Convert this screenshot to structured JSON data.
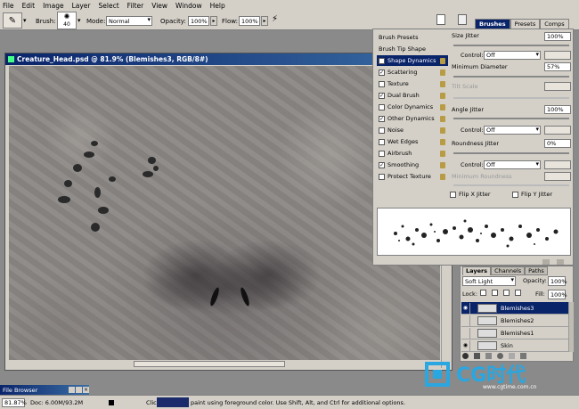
{
  "menu": [
    "File",
    "Edit",
    "Image",
    "Layer",
    "Select",
    "Filter",
    "View",
    "Window",
    "Help"
  ],
  "options_bar": {
    "brush_label": "Brush:",
    "brush_size": "40",
    "mode_label": "Mode:",
    "mode_value": "Normal",
    "opacity_label": "Opacity:",
    "opacity_value": "100%",
    "flow_label": "Flow:",
    "flow_value": "100%"
  },
  "palette_well": {
    "tabs": [
      "Brushes",
      "Presets",
      "Comps"
    ]
  },
  "document": {
    "title": "Creature_Head.psd @ 81.9% (Blemishes3, RGB/8#)"
  },
  "brushes_panel": {
    "items": [
      {
        "label": "Brush Presets",
        "checkbox": false,
        "checked": false,
        "lock": false
      },
      {
        "label": "Brush Tip Shape",
        "checkbox": false,
        "checked": false,
        "lock": false
      },
      {
        "label": "Shape Dynamics",
        "checkbox": true,
        "checked": true,
        "lock": true,
        "selected": true
      },
      {
        "label": "Scattering",
        "checkbox": true,
        "checked": true,
        "lock": true
      },
      {
        "label": "Texture",
        "checkbox": true,
        "checked": false,
        "lock": true
      },
      {
        "label": "Dual Brush",
        "checkbox": true,
        "checked": true,
        "lock": true
      },
      {
        "label": "Color Dynamics",
        "checkbox": true,
        "checked": false,
        "lock": true
      },
      {
        "label": "Other Dynamics",
        "checkbox": true,
        "checked": true,
        "lock": true
      },
      {
        "label": "Noise",
        "checkbox": true,
        "checked": false,
        "lock": true
      },
      {
        "label": "Wet Edges",
        "checkbox": true,
        "checked": false,
        "lock": true
      },
      {
        "label": "Airbrush",
        "checkbox": true,
        "checked": false,
        "lock": true
      },
      {
        "label": "Smoothing",
        "checkbox": true,
        "checked": true,
        "lock": true
      },
      {
        "label": "Protect Texture",
        "checkbox": true,
        "checked": false,
        "lock": true
      }
    ],
    "size_jitter_label": "Size Jitter",
    "size_jitter_value": "100%",
    "control_label": "Control:",
    "control_value": "Off",
    "min_diameter_label": "Minimum Diameter",
    "min_diameter_value": "57%",
    "tilt_scale_label": "Tilt Scale",
    "angle_jitter_label": "Angle Jitter",
    "angle_jitter_value": "100%",
    "roundness_jitter_label": "Roundness Jitter",
    "roundness_jitter_value": "0%",
    "min_roundness_label": "Minimum Roundness",
    "flip_x_label": "Flip X Jitter",
    "flip_y_label": "Flip Y Jitter"
  },
  "layers_panel": {
    "tabs": [
      "Layers",
      "Channels",
      "Paths"
    ],
    "blend_mode": "Soft Light",
    "opacity_label": "Opacity:",
    "opacity_value": "100%",
    "lock_label": "Lock:",
    "fill_label": "Fill:",
    "fill_value": "100%",
    "layers": [
      {
        "name": "Blemishes3",
        "selected": true,
        "visible": true
      },
      {
        "name": "Blemishes2",
        "selected": false,
        "visible": false
      },
      {
        "name": "Blemishes1",
        "selected": false,
        "visible": false
      },
      {
        "name": "Skin",
        "selected": false,
        "visible": true
      }
    ]
  },
  "status_bar": {
    "zoom": "81.87%",
    "doc_info": "Doc: 6.00M/93.2M",
    "hint_prefix": "Click",
    "hint": "paint using foreground color.  Use Shift, Alt, and Ctrl for additional options."
  },
  "file_browser": {
    "label": "File Browser"
  },
  "watermark": {
    "text": "CG时代",
    "url": "www.cgtime.com.cn"
  },
  "colors": {
    "title_bar": "#0a246a",
    "panel_bg": "#d4d0c8",
    "selection": "#0a246a"
  }
}
